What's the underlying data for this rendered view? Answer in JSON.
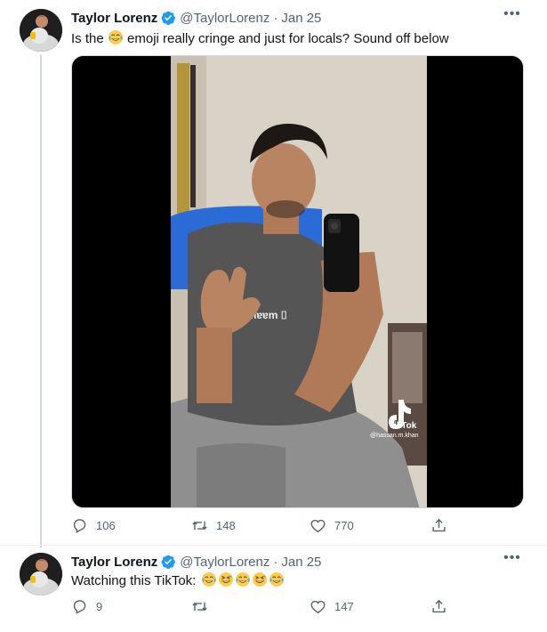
{
  "tweets": [
    {
      "author_name": "Taylor Lorenz",
      "handle": "@TaylorLorenz",
      "separator": "·",
      "date": "Jan 25",
      "text_before_emoji": "Is the",
      "text_after_emoji": "emoji really cringe and just for locals? Sound off below",
      "inline_emoji": "face-with-tears-of-joy",
      "media": {
        "type": "video",
        "watermark_brand": "TikTok",
        "watermark_handle": "@hassan.m.khan",
        "shirt_logo_text": "ᴎɐɐm ⌷"
      },
      "stats": {
        "replies": "106",
        "retweets": "148",
        "likes": "770"
      }
    },
    {
      "author_name": "Taylor Lorenz",
      "handle": "@TaylorLorenz",
      "separator": "·",
      "date": "Jan 25",
      "text": "Watching this TikTok:",
      "emoji_sequence": [
        "face-with-tears-of-joy",
        "grinning-squinting-face",
        "face-with-tears-of-joy",
        "grinning-squinting-face",
        "face-with-tears-of-joy"
      ],
      "stats": {
        "replies": "9",
        "retweets": "",
        "likes": "147"
      }
    }
  ],
  "icons": {
    "more": "more-icon",
    "verified": "verified-badge-icon",
    "reply": "reply-icon",
    "retweet": "retweet-icon",
    "like": "heart-icon",
    "share": "share-icon"
  },
  "colors": {
    "text": "#0f1419",
    "secondary": "#536471",
    "verified": "#1d9bf0",
    "thread_line": "#cfd9de"
  }
}
